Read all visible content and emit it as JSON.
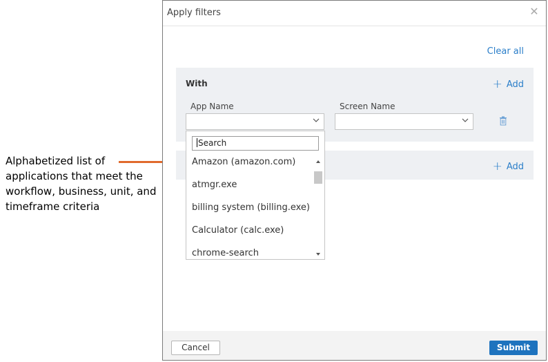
{
  "annotation": {
    "text": "Alphabetized list of applications that meet the workflow, business, unit, and timeframe criteria",
    "color": "#e06a2c"
  },
  "dialog": {
    "title": "Apply filters",
    "close_icon": "close-icon",
    "clear_all_label": "Clear all"
  },
  "with_section": {
    "title": "With",
    "add_label": "Add",
    "app_name_label": "App Name",
    "app_name_value": "",
    "screen_name_label": "Screen Name",
    "screen_name_value": "",
    "delete_icon": "trash-icon"
  },
  "second_section": {
    "add_label": "Add"
  },
  "dropdown": {
    "search_placeholder": "Search",
    "items": [
      "Amazon (amazon.com)",
      "atmgr.exe",
      "billing system (billing.exe)",
      "Calculator (calc.exe)",
      "chrome-search"
    ]
  },
  "footer": {
    "cancel_label": "Cancel",
    "submit_label": "Submit"
  },
  "colors": {
    "accent": "#2a7ec9",
    "submit": "#1e73be",
    "panel_bg": "#eef0f3"
  }
}
